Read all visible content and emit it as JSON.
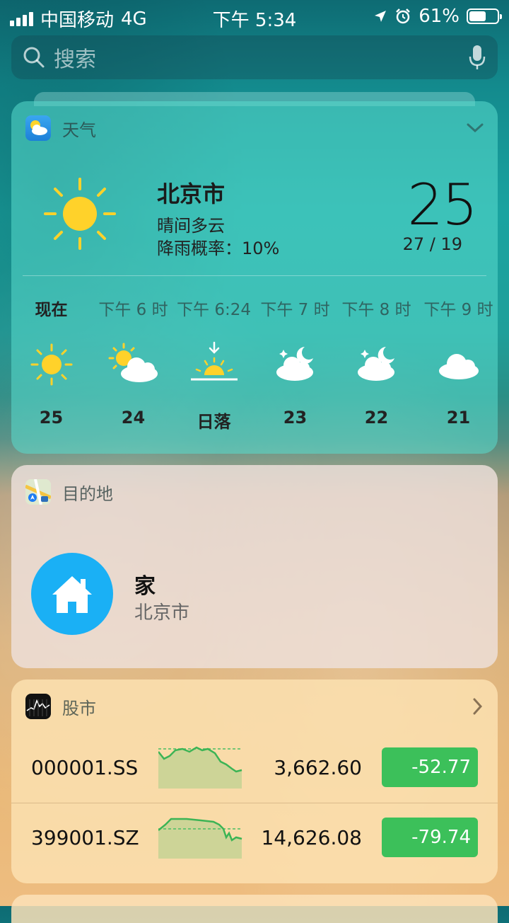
{
  "status_bar": {
    "carrier": "中国移动",
    "network": "4G",
    "time": "下午 5:34",
    "battery_percent": "61%",
    "battery_level": 0.61
  },
  "search": {
    "placeholder": "搜索"
  },
  "weather": {
    "title": "天气",
    "city": "北京市",
    "condition": "晴间多云",
    "rain_label": "降雨概率：",
    "rain_value": "10%",
    "temperature": "25",
    "high_low": "27 / 19",
    "hourly": [
      {
        "time": "现在",
        "icon": "sun-icon",
        "value": "25"
      },
      {
        "time": "下午 6 时",
        "icon": "partly-cloudy-icon",
        "value": "24"
      },
      {
        "time": "下午 6:24",
        "icon": "sunset-icon",
        "value": "日落"
      },
      {
        "time": "下午 7 时",
        "icon": "cloudy-night-icon",
        "value": "23"
      },
      {
        "time": "下午 8 时",
        "icon": "cloudy-night-icon",
        "value": "22"
      },
      {
        "time": "下午 9 时",
        "icon": "cloud-icon",
        "value": "21"
      }
    ]
  },
  "destinations": {
    "title": "目的地",
    "name": "家",
    "subtitle": "北京市"
  },
  "stocks": {
    "title": "股市",
    "rows": [
      {
        "symbol": "000001.SS",
        "price": "3,662.60",
        "change": "-52.77"
      },
      {
        "symbol": "399001.SZ",
        "price": "14,626.08",
        "change": "-79.74"
      }
    ],
    "change_color": "#3cc05a"
  }
}
